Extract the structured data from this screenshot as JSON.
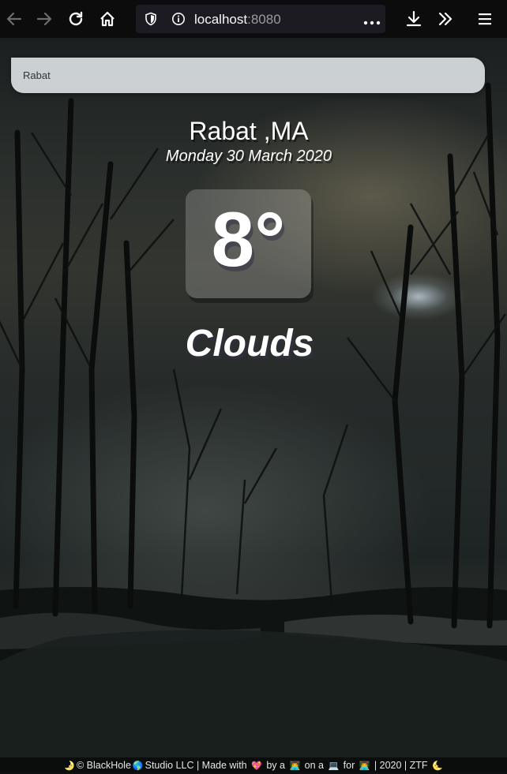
{
  "browser": {
    "url_host": "localhost",
    "url_port": ":8080",
    "icons": [
      "back-icon",
      "forward-icon",
      "reload-icon",
      "home-icon",
      "shield-icon",
      "info-icon",
      "page-actions-icon",
      "download-icon",
      "overflow-icon",
      "menu-icon"
    ]
  },
  "search": {
    "value": "Rabat"
  },
  "weather": {
    "location": "Rabat ,MA",
    "date": "Monday 30 March 2020",
    "temperature": "8°",
    "condition": "Clouds"
  },
  "footer": {
    "moon_left": "🌛",
    "copyright": "© BlackHole",
    "globe": "🌎",
    "studio": "Studio LLC | Made with",
    "heart": "💖",
    "by_a": "by a",
    "person1": "👨‍💻",
    "on_a": "on a",
    "laptop": "💻",
    "for": "for",
    "person2": "👨‍💻",
    "tail": "| 2020 | ZTF",
    "moon_right": "🌜"
  }
}
